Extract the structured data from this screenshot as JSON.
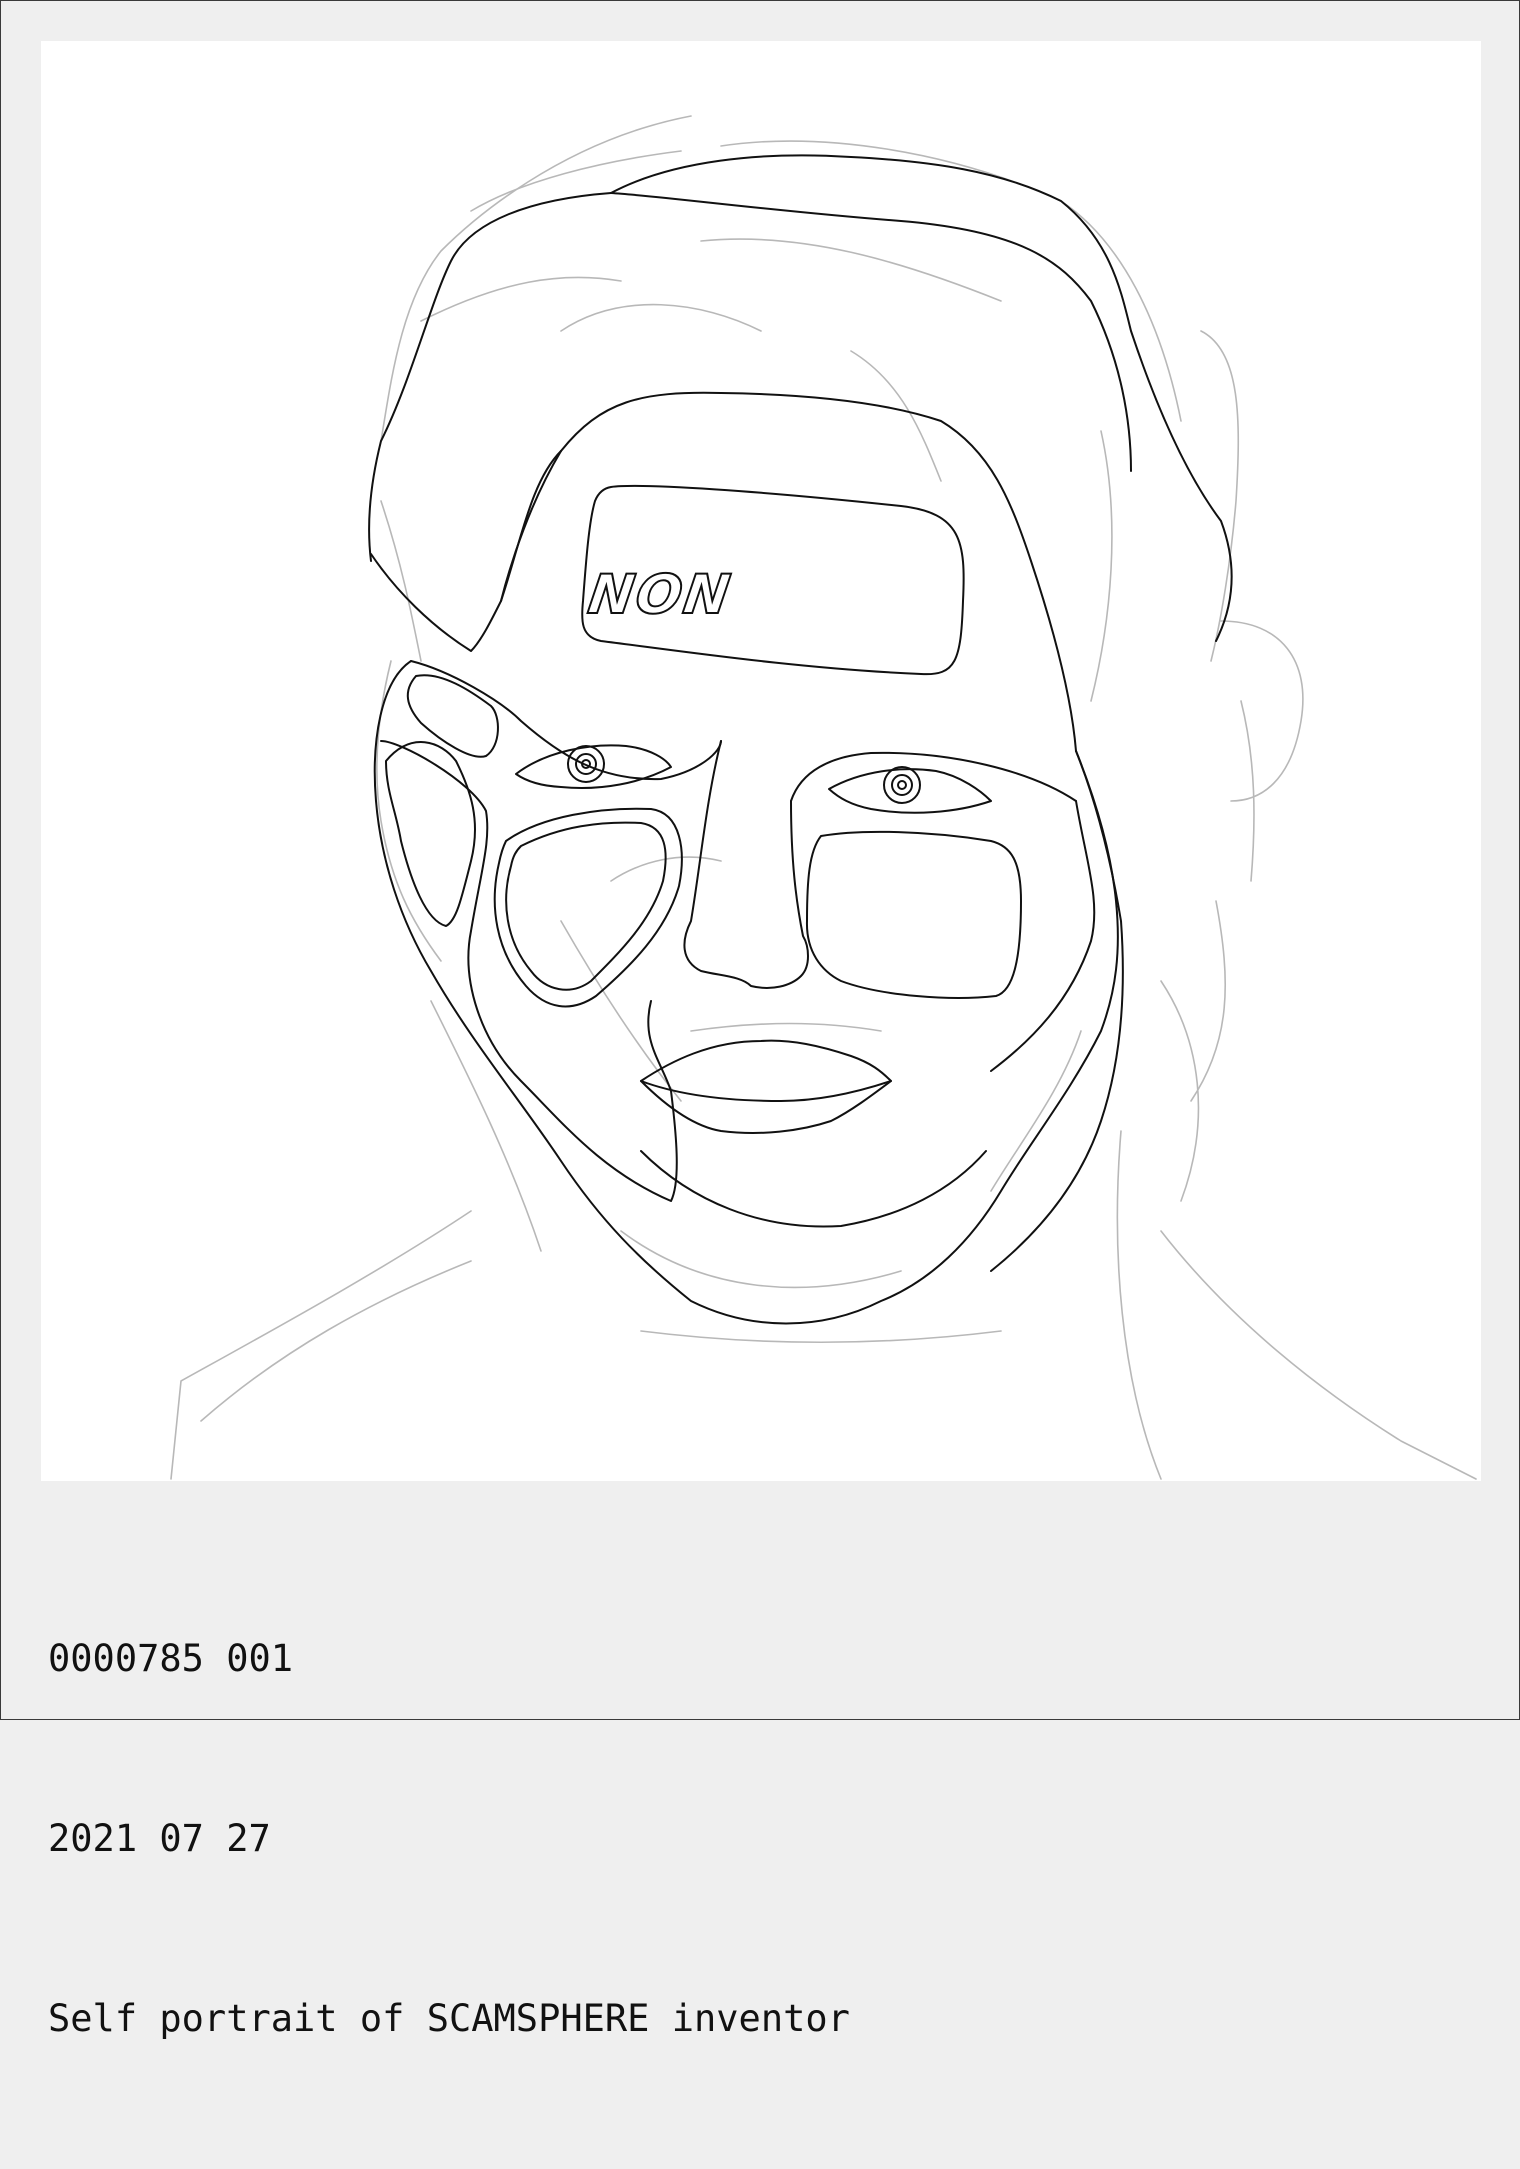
{
  "artwork": {
    "forehead_text": "NON"
  },
  "caption": {
    "id_line": "0000785 001",
    "date_line": "2021 07 27",
    "title_line": "Self portrait of SCAMSPHERE inventor"
  }
}
